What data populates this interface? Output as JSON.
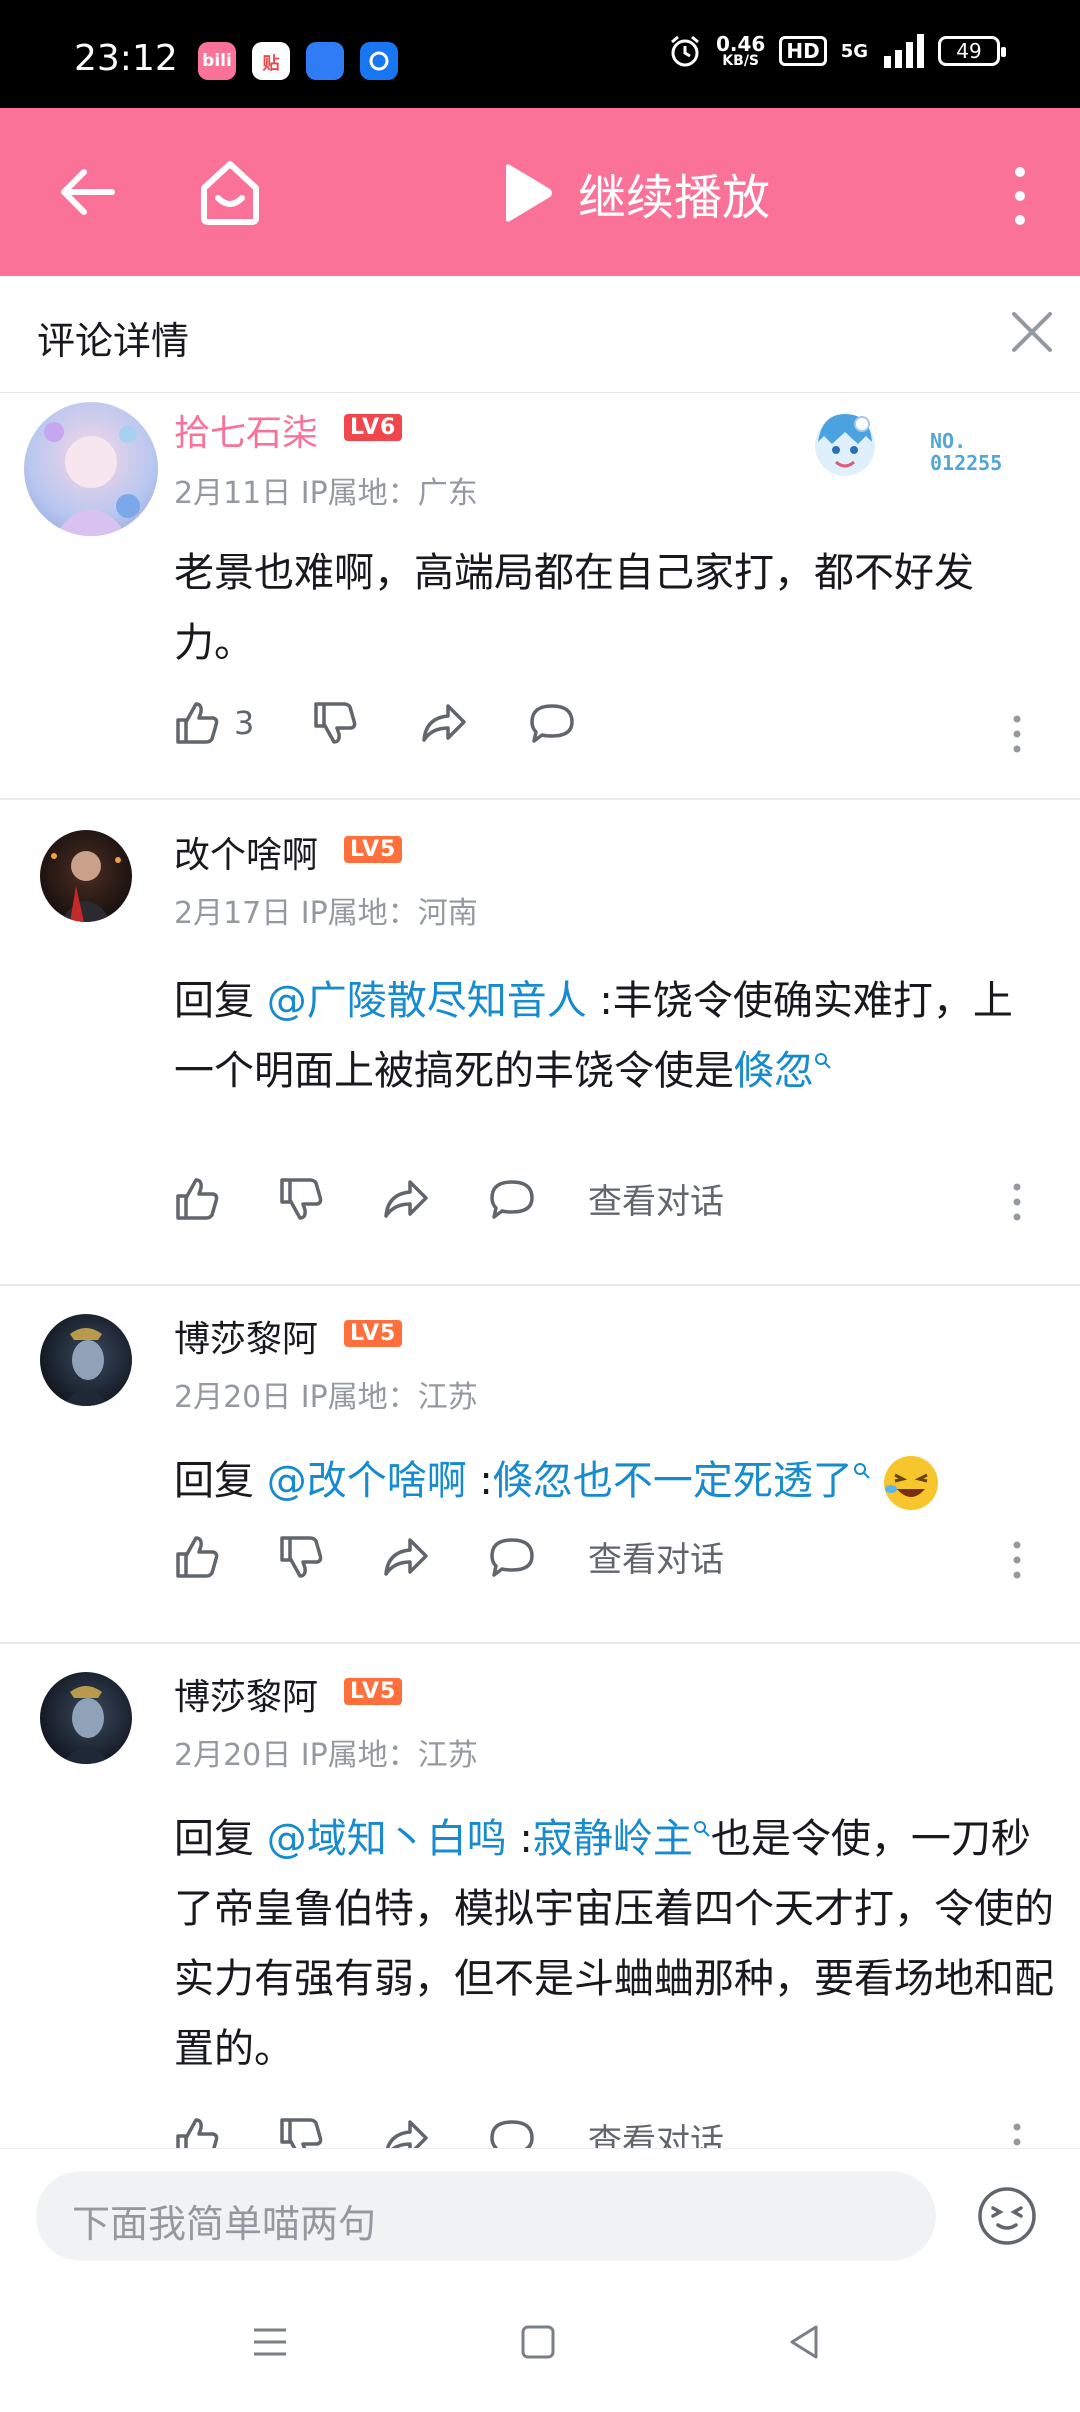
{
  "status_bar": {
    "time": "23:12",
    "app_icons": [
      {
        "name": "bilibili-app-icon",
        "label": "bili",
        "color": "#fb7299"
      },
      {
        "name": "tieba-app-icon",
        "label": "贴",
        "color": "#e64a4a"
      },
      {
        "name": "notes-app-icon",
        "label": "",
        "color": "#2f7cf6"
      },
      {
        "name": "browser-app-icon",
        "label": "",
        "color": "#1976f2"
      }
    ],
    "net_speed_value": "0.46",
    "net_speed_unit": "KB/S",
    "hd_label": "HD",
    "signal_label": "5G",
    "battery": "49"
  },
  "header": {
    "play_title": "继续播放",
    "bg_color": "#fb7299"
  },
  "panel": {
    "title": "评论详情"
  },
  "fan_badge": {
    "no_label": "NO.",
    "no_number": "012255"
  },
  "comments": [
    {
      "user": "拾七石柒",
      "level": "LV6",
      "date": "2月11日 IP属地：广东",
      "text": "老景也难啊，高端局都在自己家打，都不好发力。",
      "likes": "3"
    },
    {
      "user": "改个啥啊",
      "level": "LV5",
      "date": "2月17日 IP属地：河南",
      "reply_prefix": "回复 ",
      "mention": "@广陵散尽知音人",
      "text_a": " :丰饶令使确实难打，上一个明面上被搞死的丰饶令使是",
      "link": "倏忽",
      "view_conversation": "查看对话"
    },
    {
      "user": "博莎黎阿",
      "level": "LV5",
      "date": "2月20日 IP属地：江苏",
      "reply_prefix": "回复 ",
      "mention": "@改个啥啊",
      "text_a": " :",
      "link": "倏忽也不一定死透了",
      "view_conversation": "查看对话"
    },
    {
      "user": "博莎黎阿",
      "level": "LV5",
      "date": "2月20日 IP属地：江苏",
      "reply_prefix": "回复 ",
      "mention": "@域知丶白鸣",
      "text_a": " :",
      "link": "寂静岭主",
      "text_b": "也是令使，一刀秒了帝皇鲁伯特，模拟宇宙压着四个天才打，令使的实力有强有弱，但不是斗蛐蛐那种，要看场地和配置的。",
      "view_conversation": "查看对话"
    }
  ],
  "input": {
    "placeholder": "下面我简单喵两句"
  }
}
